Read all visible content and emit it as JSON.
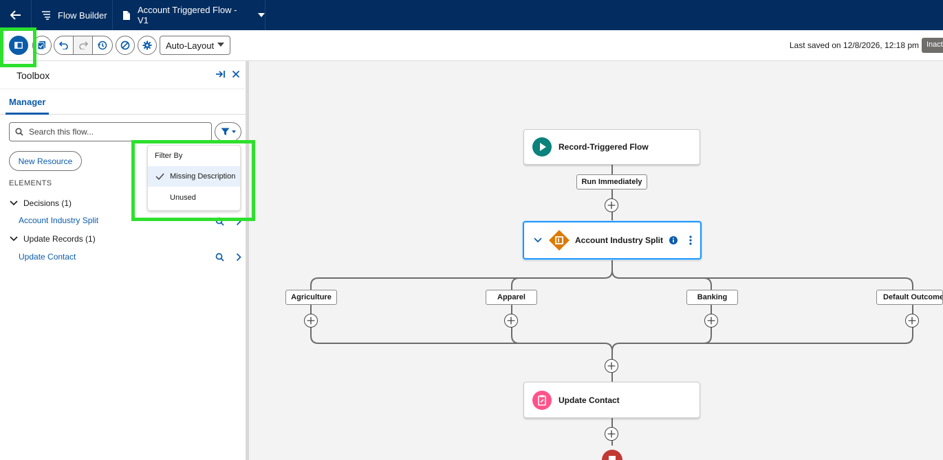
{
  "header": {
    "app_name": "Flow Builder",
    "flow_title": "Account Triggered Flow - V1",
    "icons": [
      "arrow-left-icon",
      "flow-icon",
      "document-icon",
      "caret-down-icon"
    ]
  },
  "toolbar": {
    "layout_mode": "Auto-Layout",
    "last_saved": "Last saved on 12/8/2026, 12:18 pm",
    "status": "Inactive",
    "icons": [
      "toggle-panel-icon",
      "check-flow-icon",
      "undo-icon",
      "redo-icon",
      "history-icon",
      "debug-icon",
      "settings-icon"
    ]
  },
  "panel": {
    "title": "Toolbox",
    "tab": "Manager",
    "search_placeholder": "Search this flow...",
    "new_resource": "New Resource",
    "elements_header": "ELEMENTS",
    "groups": [
      {
        "label": "Decisions (1)",
        "items": [
          {
            "label": "Account Industry Split"
          }
        ]
      },
      {
        "label": "Update Records (1)",
        "items": [
          {
            "label": "Update Contact"
          }
        ]
      }
    ]
  },
  "filter_menu": {
    "title": "Filter By",
    "options": [
      {
        "label": "Missing Description",
        "selected": true
      },
      {
        "label": "Unused",
        "selected": false
      }
    ]
  },
  "canvas": {
    "start_node": "Record-Triggered Flow",
    "run_label": "Run Immediately",
    "decision_node": "Account Industry Split",
    "outcomes": [
      "Agriculture",
      "Apparel",
      "Banking",
      "Default Outcome"
    ],
    "update_node": "Update Contact"
  },
  "colors": {
    "header_bg": "#032d60",
    "brand_blue": "#0b5cab",
    "start_icon": "#0b827c",
    "decision_icon": "#dd7a01",
    "update_icon": "#ff538a",
    "end_icon": "#c23934",
    "annotation_highlight": "#2ee02e"
  }
}
